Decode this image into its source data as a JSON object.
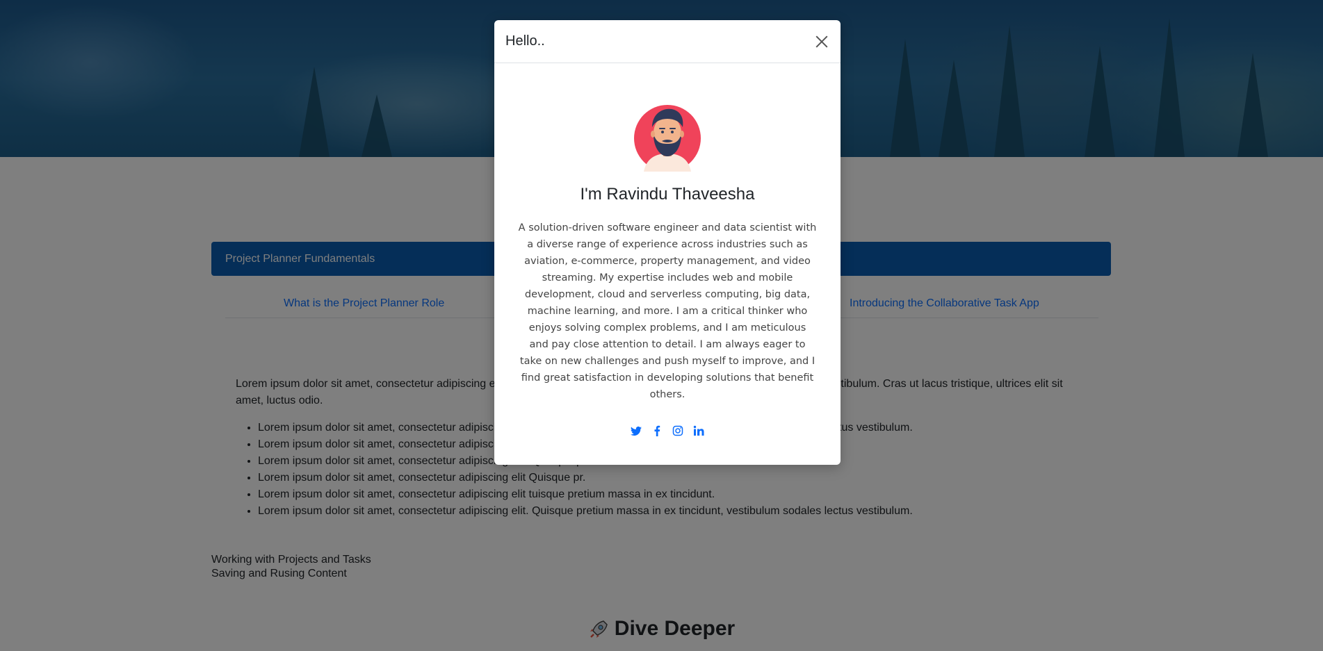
{
  "modal": {
    "title": "Hello..",
    "name": "I'm Ravindu Thaveesha",
    "bio": "A solution-driven software engineer and data scientist with a diverse range of experience across industries such as aviation, e-commerce, property management, and video streaming. My expertise includes web and mobile development, cloud and serverless computing, big data, machine learning, and more. I am a critical thinker who enjoys solving complex problems, and I am meticulous and pay close attention to detail. I am always eager to take on new challenges and push myself to improve, and I find great satisfaction in developing solutions that benefit others.",
    "socials": [
      "twitter-icon",
      "facebook-icon",
      "instagram-icon",
      "linkedin-icon"
    ]
  },
  "accordion": {
    "header": "Project Planner Fundamentals",
    "links": [
      "What is the Project Planner Role",
      "Introducing the Collaborative Task App"
    ]
  },
  "content": {
    "paragraph_start": "Lorem ipsum dolor sit amet, consectetur adipiscing e",
    "paragraph_end": "estibulum. Cras ut lacus tristique, ultrices elit sit",
    "paragraph_tail": "amet, luctus odio.",
    "bullets": [
      "Lorem ipsum dolor sit amet, consectetur adipiscing elit. Quisque pretium massa in ex tincidunt, vestibulum sodales lectus vestibulum.",
      "Lorem ipsum dolor sit amet, consectetur adipiscing",
      "Lorem ipsum dolor sit amet, consectetur adipiscing elit. Quisque pretium massa in ex tincidunt.",
      "Lorem ipsum dolor sit amet, consectetur adipiscing elit Quisque pr.",
      "Lorem ipsum dolor sit amet, consectetur adipiscing elit tuisque pretium massa in ex tincidunt.",
      "Lorem ipsum dolor sit amet, consectetur adipiscing elit. Quisque pretium massa in ex tincidunt, vestibulum sodales lectus vestibulum."
    ],
    "links": [
      "Working with Projects and Tasks",
      "Saving and Rusing Content"
    ],
    "section_heading": "Dive Deeper"
  },
  "colors": {
    "primary": "#0d6efd",
    "avatar_bg": "#f0435a",
    "backdrop": "rgba(0,0,0,0.5)"
  }
}
